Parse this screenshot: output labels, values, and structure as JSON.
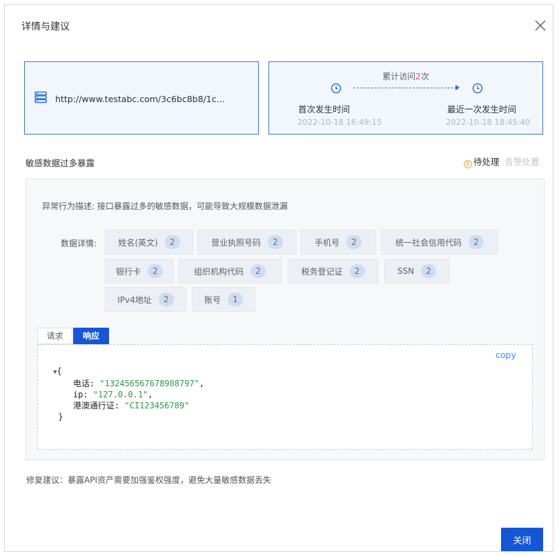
{
  "dialog": {
    "title": "详情与建议",
    "close_icon": "close-icon"
  },
  "url_card": {
    "icon": "server-icon",
    "url": "http://www.testabc.com/3c6bc8b8/1c..."
  },
  "time_card": {
    "visit_prefix": "累计访问",
    "visit_count": "2",
    "visit_suffix": "次",
    "first_label": "首次发生时间",
    "first_value": "2022-10-18 16:49:15",
    "last_label": "最近一次发生时间",
    "last_value": "2022-10-18 18:45:40",
    "clock_icon": "clock-icon"
  },
  "issue": {
    "title": "敏感数据过多暴露",
    "status_pending": "待处理",
    "status_handled": "告警处置",
    "desc_label": "异常行为描述:",
    "desc_text": "接口暴露过多的敏感数据，可能导致大规模数据泄漏",
    "detail_label": "数据详情:",
    "tags": [
      {
        "label": "姓名(英文)",
        "count": "2"
      },
      {
        "label": "营业执照号码",
        "count": "2"
      },
      {
        "label": "手机号",
        "count": "2"
      },
      {
        "label": "统一社会信用代码",
        "count": "2"
      },
      {
        "label": "银行卡",
        "count": "2"
      },
      {
        "label": "组织机构代码",
        "count": "2"
      },
      {
        "label": "税务登记证",
        "count": "2"
      },
      {
        "label": "SSN",
        "count": "2"
      },
      {
        "label": "IPv4地址",
        "count": "2"
      },
      {
        "label": "账号",
        "count": "1"
      }
    ]
  },
  "tabs": {
    "request": "请求",
    "response": "响应",
    "active": "response"
  },
  "code": {
    "copy_label": "copy",
    "open": "{",
    "close": "}",
    "lines": [
      {
        "key": "电话",
        "value": "\"132456567678908797\"",
        "trail": ","
      },
      {
        "key": "ip",
        "value": "\"127.0.0.1\"",
        "trail": ","
      },
      {
        "key": "港澳通行证",
        "value": "\"CI123456789\"",
        "trail": ""
      }
    ]
  },
  "advice": {
    "text": "修复建议：暴露API资产需要加强鉴权强度，避免大量敏感数据丢失"
  },
  "footer": {
    "close_label": "关闭"
  },
  "colors": {
    "primary": "#1556d6",
    "highlight": "#e84a4a",
    "pending": "#f2a33a",
    "code_string": "#2b9a47"
  }
}
